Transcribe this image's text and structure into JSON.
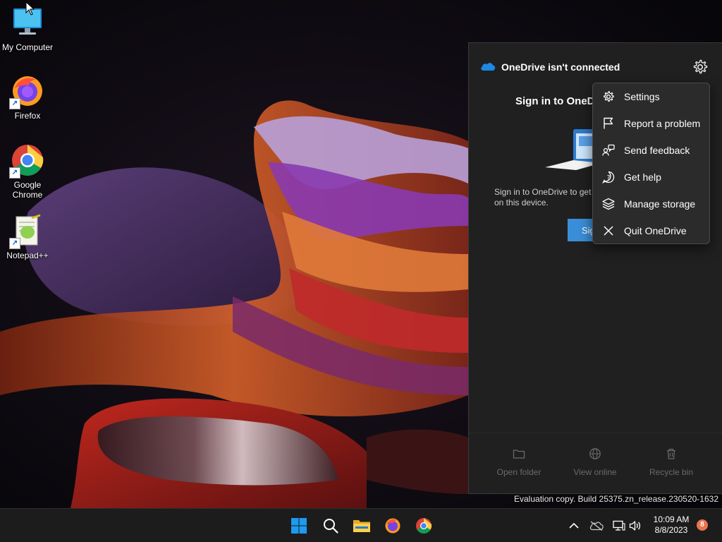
{
  "desktop": {
    "icons": [
      {
        "label": "My Computer",
        "icon": "monitor-icon"
      },
      {
        "label": "Firefox",
        "icon": "firefox-icon"
      },
      {
        "label": "Google Chrome",
        "icon": "chrome-icon"
      },
      {
        "label": "Notepad++",
        "icon": "notepadpp-icon"
      }
    ],
    "shortcut_arrow": "↗"
  },
  "onedrive": {
    "title": "OneDrive isn't connected",
    "signin_title": "Sign in to OneD",
    "description": "Sign in to OneDrive to get on this device.",
    "signin_button": "Sig",
    "footer": {
      "open_folder": "Open folder",
      "view_online": "View online",
      "recycle_bin": "Recycle bin"
    }
  },
  "context_menu": {
    "items": [
      {
        "label": "Settings",
        "icon": "gear-icon"
      },
      {
        "label": "Report a problem",
        "icon": "flag-icon"
      },
      {
        "label": "Send feedback",
        "icon": "feedback-icon"
      },
      {
        "label": "Get help",
        "icon": "help-icon"
      },
      {
        "label": "Manage storage",
        "icon": "layers-icon"
      },
      {
        "label": "Quit OneDrive",
        "icon": "close-icon"
      }
    ]
  },
  "watermark": "Evaluation copy. Build 25375.zn_release.230520-1632",
  "taskbar": {
    "apps": [
      "start-icon",
      "search-icon",
      "file-explorer-icon",
      "firefox-icon",
      "chrome-icon"
    ],
    "tray": [
      "chevron-up-icon",
      "onedrive-offline-icon",
      "network-icon",
      "volume-icon"
    ],
    "time": "10:09 AM",
    "date": "8/8/2023",
    "notification_count": "8"
  },
  "colors": {
    "accent": "#3a8ed8",
    "panel": "#202020",
    "menu": "#2b2b2b",
    "badge": "#e8754f"
  }
}
